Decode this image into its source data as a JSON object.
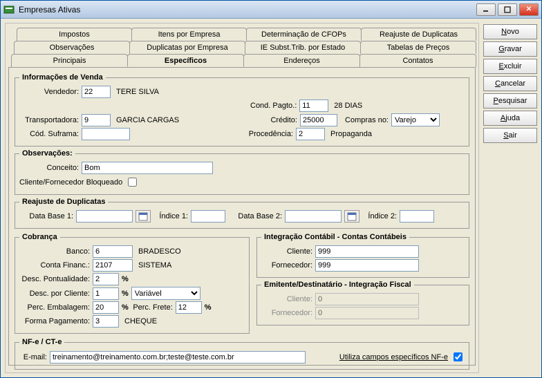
{
  "window": {
    "title": "Empresas Ativas"
  },
  "tabs": {
    "row1": [
      "Impostos",
      "Itens por Empresa",
      "Determinação de CFOPs",
      "Reajuste de Duplicatas"
    ],
    "row2": [
      "Observações",
      "Duplicatas por Empresa",
      "IE Subst.Trib. por Estado",
      "Tabelas de Preços"
    ],
    "row3": [
      "Principais",
      "Específicos",
      "Endereços",
      "Contatos"
    ],
    "active": "Específicos"
  },
  "sidebar": {
    "novo": "Novo",
    "gravar": "Gravar",
    "excluir": "Excluir",
    "cancelar": "Cancelar",
    "pesquisar": "Pesquisar",
    "ajuda": "Ajuda",
    "sair": "Sair"
  },
  "venda": {
    "legend": "Informações de Venda",
    "vendedor_label": "Vendedor:",
    "vendedor": "22",
    "vendedor_desc": "TERE SILVA",
    "cond_pagto_label": "Cond. Pagto.:",
    "cond_pagto": "11",
    "cond_pagto_desc": "28 DIAS",
    "transportadora_label": "Transportadora:",
    "transportadora": "9",
    "transportadora_desc": "GARCIA CARGAS",
    "credito_label": "Crédito:",
    "credito": "25000",
    "compras_no_label": "Compras no:",
    "compras_no": "Varejo",
    "cod_suframa_label": "Cód. Suframa:",
    "cod_suframa": "",
    "procedencia_label": "Procedência:",
    "procedencia": "2",
    "procedencia_desc": "Propaganda"
  },
  "obs": {
    "legend": "Observações:",
    "conceito_label": "Conceito:",
    "conceito": "Bom",
    "bloqueado_label": "Cliente/Fornecedor Bloqueado"
  },
  "reajuste": {
    "legend": "Reajuste de Duplicatas",
    "data1_label": "Data Base 1:",
    "data1": "",
    "indice1_label": "Índice 1:",
    "indice1": "",
    "data2_label": "Data Base 2:",
    "data2": "",
    "indice2_label": "Índice 2:",
    "indice2": ""
  },
  "cobranca": {
    "legend": "Cobrança",
    "banco_label": "Banco:",
    "banco": "6",
    "banco_desc": "BRADESCO",
    "conta_label": "Conta Financ.:",
    "conta": "2107",
    "conta_desc": "SISTEMA",
    "pontualidade_label": "Desc. Pontualidade:",
    "pontualidade": "2",
    "pct": "%",
    "desc_cliente_label": "Desc. por Cliente:",
    "desc_cliente": "1",
    "desc_cliente_tipo": "Variável",
    "perc_emb_label": "Perc. Embalagem:",
    "perc_emb": "20",
    "perc_frete_label": "Perc. Frete:",
    "perc_frete": "12",
    "forma_pg_label": "Forma Pagamento:",
    "forma_pg": "3",
    "forma_pg_desc": "CHEQUE"
  },
  "integracao": {
    "legend": "Integração Contábil - Contas Contábeis",
    "cliente_label": "Cliente:",
    "cliente": "999",
    "fornecedor_label": "Fornecedor:",
    "fornecedor": "999"
  },
  "fiscal": {
    "legend": "Emitente/Destinatário - Integração Fiscal",
    "cliente_label": "Cliente:",
    "cliente": "0",
    "fornecedor_label": "Fornecedor:",
    "fornecedor": "0"
  },
  "nfe": {
    "legend": "NF-e / CT-e",
    "email_label": "E-mail:",
    "email": "treinamento@treinamento.com.br;teste@teste.com.br",
    "campos_label": "Utiliza campos específicos NF-e"
  }
}
